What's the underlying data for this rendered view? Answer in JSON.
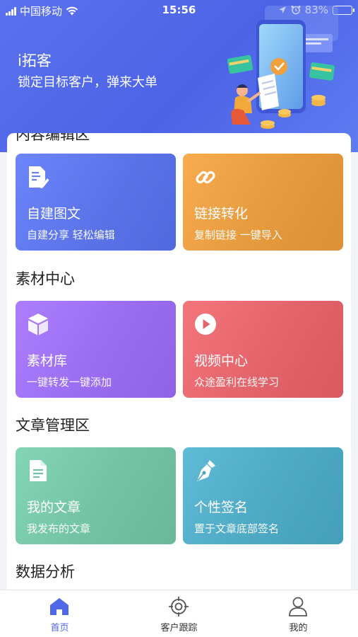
{
  "status_bar": {
    "carrier": "中国移动",
    "time": "15:56",
    "battery": "83%",
    "battery_level": 0.83
  },
  "header": {
    "app_name": "i拓客",
    "slogan": "锁定目标客户，弹来大单"
  },
  "sections": {
    "cut_off_title": "内容编辑区",
    "content_edit": {
      "tiles": [
        {
          "title": "自建图文",
          "subtitle": "自建分享 轻松编辑",
          "icon": "document-edit-icon",
          "color": "#5b73e8"
        },
        {
          "title": "链接转化",
          "subtitle": "复制链接 一键导入",
          "icon": "link-icon",
          "color": "#e69a3e"
        }
      ]
    },
    "materials": {
      "title": "素材中心",
      "tiles": [
        {
          "title": "素材库",
          "subtitle": "一键转发一键添加",
          "icon": "cube-icon",
          "color": "#9a6cf0"
        },
        {
          "title": "视频中心",
          "subtitle": "众途盈利在线学习",
          "icon": "play-icon",
          "color": "#e2646a"
        }
      ]
    },
    "articles": {
      "title": "文章管理区",
      "tiles": [
        {
          "title": "我的文章",
          "subtitle": "我发布的文章",
          "icon": "article-icon",
          "color": "#72c3a4"
        },
        {
          "title": "个性签名",
          "subtitle": "置于文章底部签名",
          "icon": "pen-nib-icon",
          "color": "#4ea9c4"
        }
      ]
    },
    "analytics": {
      "title": "数据分析"
    }
  },
  "tab_bar": {
    "tabs": [
      {
        "label": "首页",
        "icon": "home-icon",
        "active": true
      },
      {
        "label": "客户跟踪",
        "icon": "target-icon",
        "active": false
      },
      {
        "label": "我的",
        "icon": "user-icon",
        "active": false
      }
    ],
    "active_color": "#4e68e8"
  }
}
